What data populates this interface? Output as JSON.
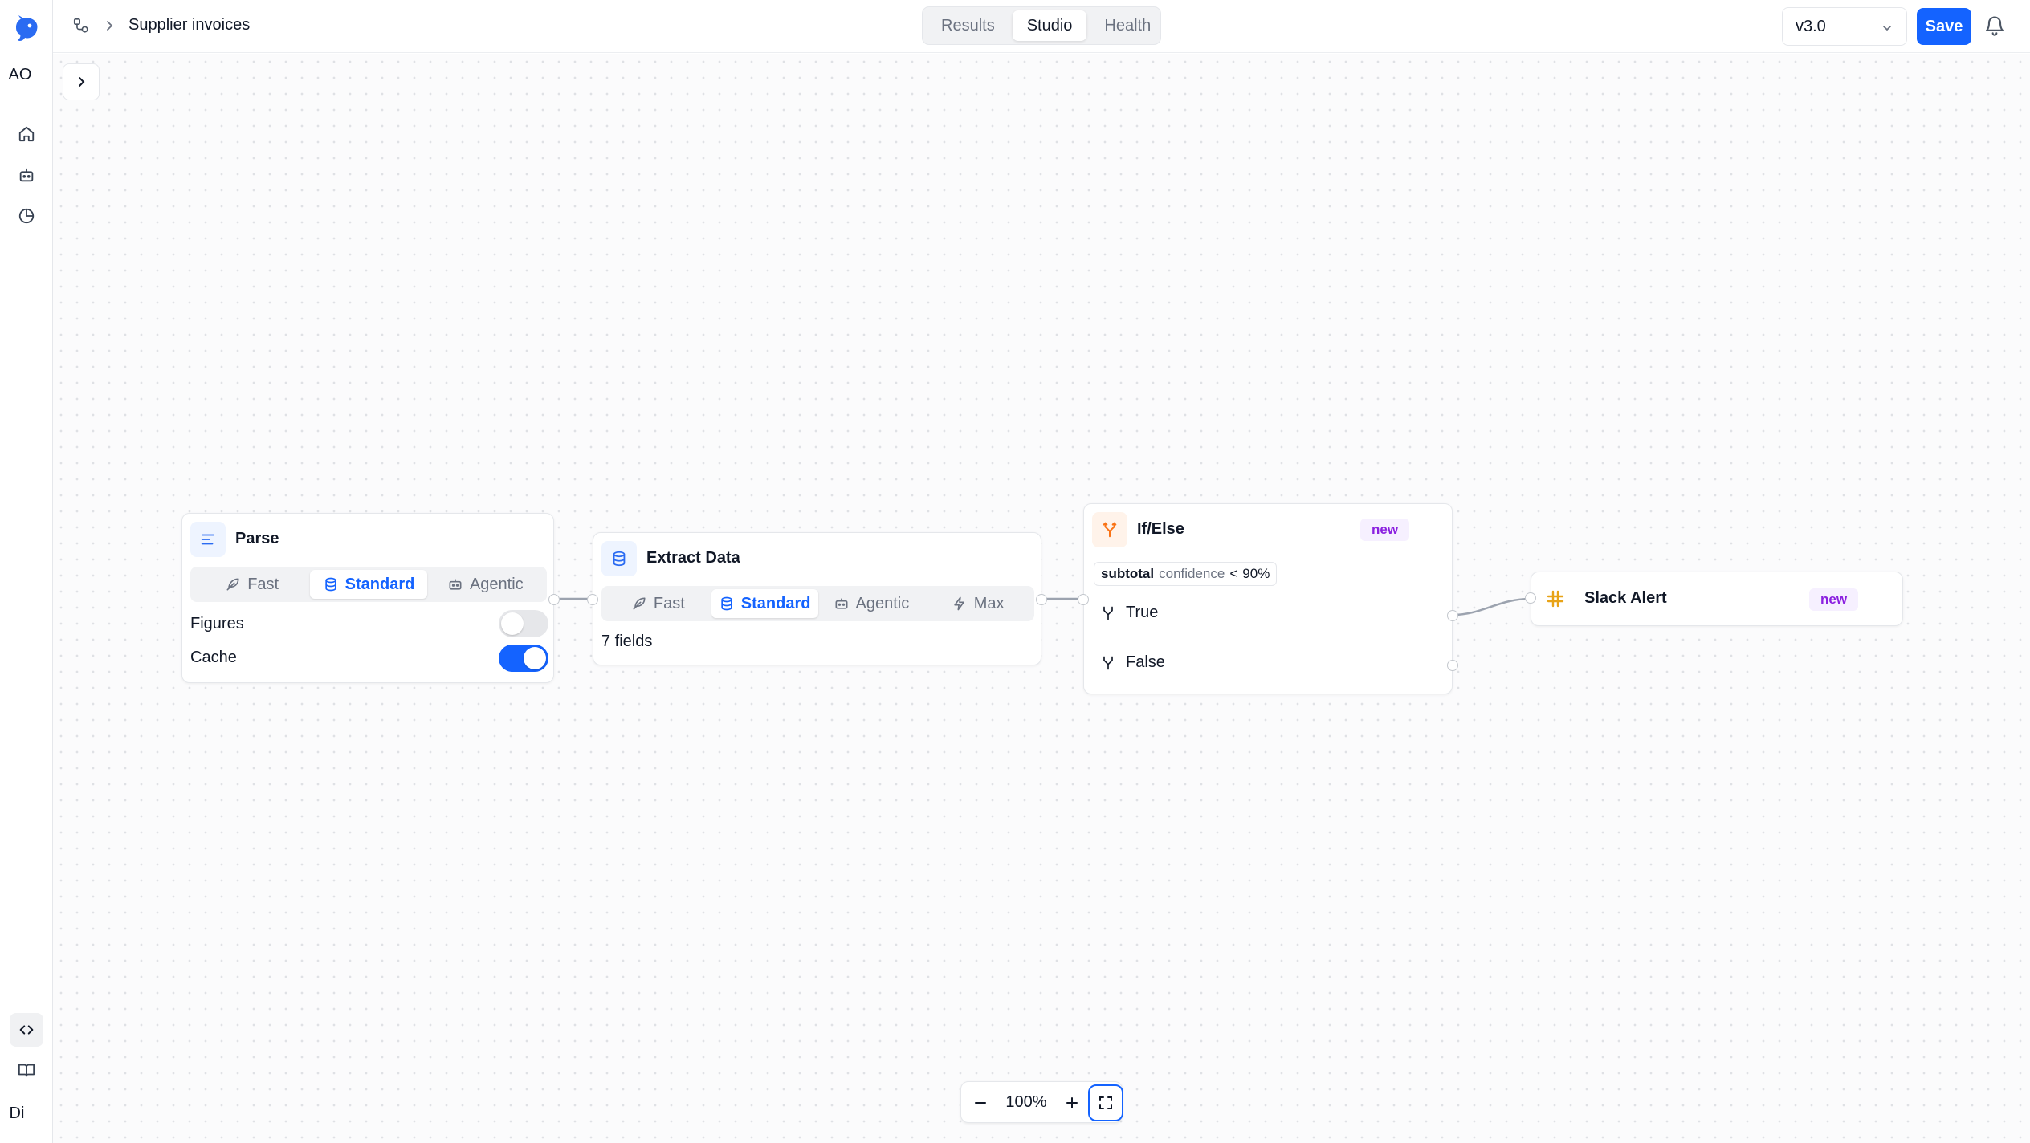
{
  "rail": {
    "workspace_initials": "AO",
    "user_initials": "Di",
    "items": [
      {
        "icon": "home-icon"
      },
      {
        "icon": "bot-icon"
      },
      {
        "icon": "pie-chart-icon"
      },
      {
        "icon": "code-icon"
      },
      {
        "icon": "book-icon"
      }
    ]
  },
  "header": {
    "breadcrumb_title": "Supplier invoices",
    "tabs": [
      {
        "label": "Results",
        "active": false
      },
      {
        "label": "Studio",
        "active": true
      },
      {
        "label": "Health",
        "active": false
      }
    ],
    "version": "v3.0",
    "save_label": "Save"
  },
  "nodes": {
    "parse": {
      "title": "Parse",
      "modes": [
        "Fast",
        "Standard",
        "Agentic"
      ],
      "active_mode": "Standard",
      "options": [
        {
          "label": "Figures",
          "enabled": false
        },
        {
          "label": "Cache",
          "enabled": true
        }
      ]
    },
    "extract": {
      "title": "Extract Data",
      "modes": [
        "Fast",
        "Standard",
        "Agentic",
        "Max"
      ],
      "active_mode": "Standard",
      "fields_label": "7 fields"
    },
    "ifelse": {
      "title": "If/Else",
      "badge": "new",
      "condition": {
        "field": "subtotal",
        "key": "confidence",
        "operator": "<",
        "value": "90%"
      },
      "branches": [
        "True",
        "False"
      ]
    },
    "slack": {
      "title": "Slack Alert",
      "badge": "new"
    }
  },
  "zoom": {
    "level": "100%"
  },
  "colors": {
    "accent": "#1463ff",
    "badge_text": "#8b21e0",
    "badge_bg": "#f6f0ff",
    "ifelse_icon": "#f97316",
    "slack_icon": "#e8a317"
  }
}
